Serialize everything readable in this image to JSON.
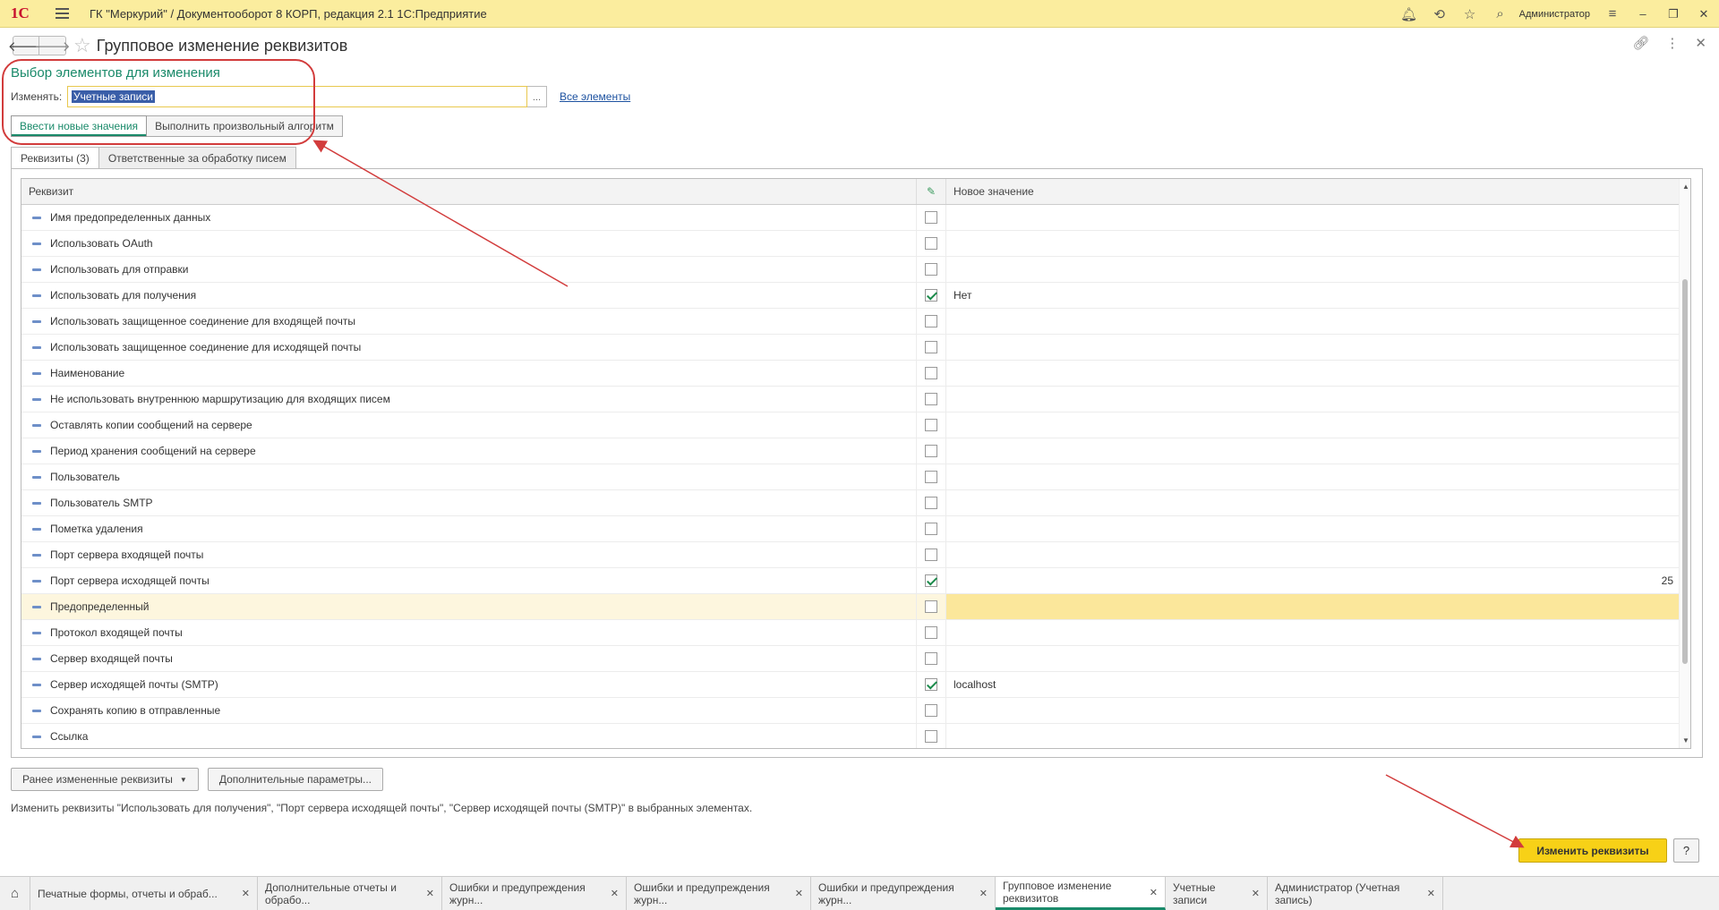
{
  "app": {
    "title": "ГК \"Меркурий\" / Документооборот 8 КОРП, редакция 2.1 1С:Предприятие",
    "user": "Администратор",
    "logo": "1С"
  },
  "page": {
    "title": "Групповое изменение реквизитов"
  },
  "selection": {
    "title": "Выбор элементов для изменения",
    "change_label": "Изменять:",
    "value": "Учетные записи",
    "dots": "...",
    "all_link": "Все элементы"
  },
  "modes": [
    "Ввести новые значения",
    "Выполнить произвольный алгоритм"
  ],
  "tabs": [
    "Реквизиты (3)",
    "Ответственные за обработку писем"
  ],
  "table": {
    "headers": [
      "Реквизит",
      "Новое значение"
    ],
    "rows": [
      {
        "name": "Имя предопределенных данных",
        "checked": false,
        "value": ""
      },
      {
        "name": "Использовать OAuth",
        "checked": false,
        "value": ""
      },
      {
        "name": "Использовать для отправки",
        "checked": false,
        "value": ""
      },
      {
        "name": "Использовать для получения",
        "checked": true,
        "value": "Нет"
      },
      {
        "name": "Использовать защищенное соединение для входящей почты",
        "checked": false,
        "value": ""
      },
      {
        "name": "Использовать защищенное соединение для исходящей почты",
        "checked": false,
        "value": ""
      },
      {
        "name": "Наименование",
        "checked": false,
        "value": ""
      },
      {
        "name": "Не использовать внутреннюю маршрутизацию для входящих писем",
        "checked": false,
        "value": ""
      },
      {
        "name": "Оставлять копии сообщений на сервере",
        "checked": false,
        "value": ""
      },
      {
        "name": "Период хранения сообщений на сервере",
        "checked": false,
        "value": ""
      },
      {
        "name": "Пользователь",
        "checked": false,
        "value": ""
      },
      {
        "name": "Пользователь SMTP",
        "checked": false,
        "value": ""
      },
      {
        "name": "Пометка удаления",
        "checked": false,
        "value": ""
      },
      {
        "name": "Порт сервера входящей почты",
        "checked": false,
        "value": ""
      },
      {
        "name": "Порт сервера исходящей почты",
        "checked": true,
        "value": "25"
      },
      {
        "name": "Предопределенный",
        "checked": false,
        "value": ""
      },
      {
        "name": "Протокол входящей почты",
        "checked": false,
        "value": ""
      },
      {
        "name": "Сервер входящей почты",
        "checked": false,
        "value": ""
      },
      {
        "name": "Сервер исходящей почты (SMTP)",
        "checked": true,
        "value": "localhost"
      },
      {
        "name": "Сохранять копию в отправленные",
        "checked": false,
        "value": ""
      },
      {
        "name": "Ссылка",
        "checked": false,
        "value": ""
      }
    ]
  },
  "buttons": {
    "prev": "Ранее измененные реквизиты",
    "extra": "Дополнительные параметры...",
    "apply": "Изменить реквизиты",
    "help": "?"
  },
  "description": "Изменить реквизиты \"Использовать для получения\", \"Порт сервера исходящей почты\", \"Сервер исходящей почты (SMTP)\" в выбранных элементах.",
  "bottom_tabs": [
    {
      "label": "Печатные формы, отчеты и обраб...",
      "active": false
    },
    {
      "label": "Дополнительные отчеты и обрабо...",
      "active": false
    },
    {
      "label": "Ошибки и предупреждения журн...",
      "active": false
    },
    {
      "label": "Ошибки и предупреждения журн...",
      "active": false
    },
    {
      "label": "Ошибки и предупреждения журн...",
      "active": false
    },
    {
      "label": "Групповое изменение реквизитов",
      "active": true
    },
    {
      "label": "Учетные записи",
      "active": false
    },
    {
      "label": "Администратор (Учетная запись)",
      "active": false
    }
  ],
  "colors": {
    "accent": "#1a8a6a",
    "topbar": "#fbed9e",
    "apply": "#f7d117",
    "highlight": "#fbe79b",
    "annotation": "#d23c3c"
  }
}
